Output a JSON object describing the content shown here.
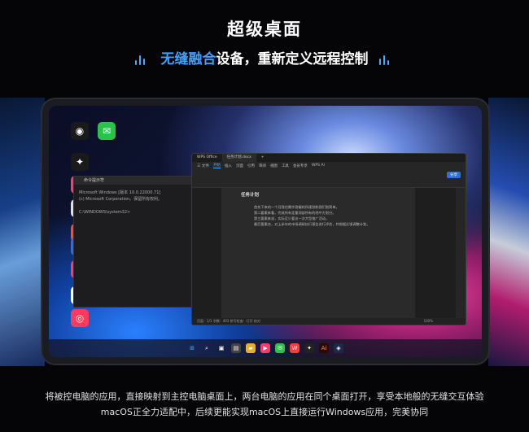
{
  "hero": {
    "title": "超级桌面",
    "subtitle_accent": "无缝融合",
    "subtitle_rest": "设备，重新定义远程控制"
  },
  "desktop_icons": [
    {
      "name": "github-icon",
      "glyph": "◉",
      "bg": "#1a1a1a"
    },
    {
      "name": "wechat-icon",
      "glyph": "✉",
      "bg": "#2ac24a"
    },
    {
      "name": "figma-icon",
      "glyph": "✦",
      "bg": "#1a1a1a"
    },
    {
      "name": "mail-icon",
      "glyph": "▶",
      "bg": "#ff3b6a"
    },
    {
      "name": "app-a-icon",
      "glyph": "A",
      "bg": "#e0e0e0"
    },
    {
      "name": "app-v-icon",
      "glyph": "V",
      "bg": "#ff4a2a"
    },
    {
      "name": "app-e-icon",
      "glyph": "E",
      "bg": "#2a70e0"
    },
    {
      "name": "app-c-icon",
      "glyph": "⊕",
      "bg": "#ff3a6a"
    },
    {
      "name": "app-k-icon",
      "glyph": "◐",
      "bg": "#ffffff"
    },
    {
      "name": "app-p-icon",
      "glyph": "◎",
      "bg": "#ff3a5a"
    }
  ],
  "cmd": {
    "title": "命令提示符",
    "lines": [
      "Microsoft Windows [版本 10.0.22000.71]",
      "(c) Microsoft Corporation。保留所有权利。",
      "",
      "C:\\WINDOWS\\system32>"
    ]
  },
  "wps": {
    "tabs": [
      "WPS Office",
      "任务计划.docx",
      "+"
    ],
    "menu": [
      "三 文件",
      "开始",
      "插入",
      "页面",
      "引用",
      "审阅",
      "视图",
      "工具",
      "会员专享",
      "WPS AI"
    ],
    "share": "分享",
    "doc_title": "任务计划",
    "doc_lines": [
      "首先下来的一个月我也需作答编的所规划和我们划简单。",
      "第二要素来看，完成所有定量测部所有的地中方划分。",
      "第三要素来说，实际至少要访一次大型推广活动。",
      "最后要素合，对上半年的市场调研执行报告进行评估，并根据反馈调整计划。"
    ],
    "status": "页面：1/1    字数：403    拼写检查：打开    校对",
    "zoom": "100%"
  },
  "caption": {
    "line1": "将被控电脑的应用，直接映射到主控电脑桌面上，两台电脑的应用在同个桌面打开，享受本地般的无缝交互体验",
    "line2": "macOS正全力适配中，后续更能实现macOS上直接运行Windows应用，完美协同"
  },
  "colors": {
    "accent": "#3fa0ff"
  }
}
